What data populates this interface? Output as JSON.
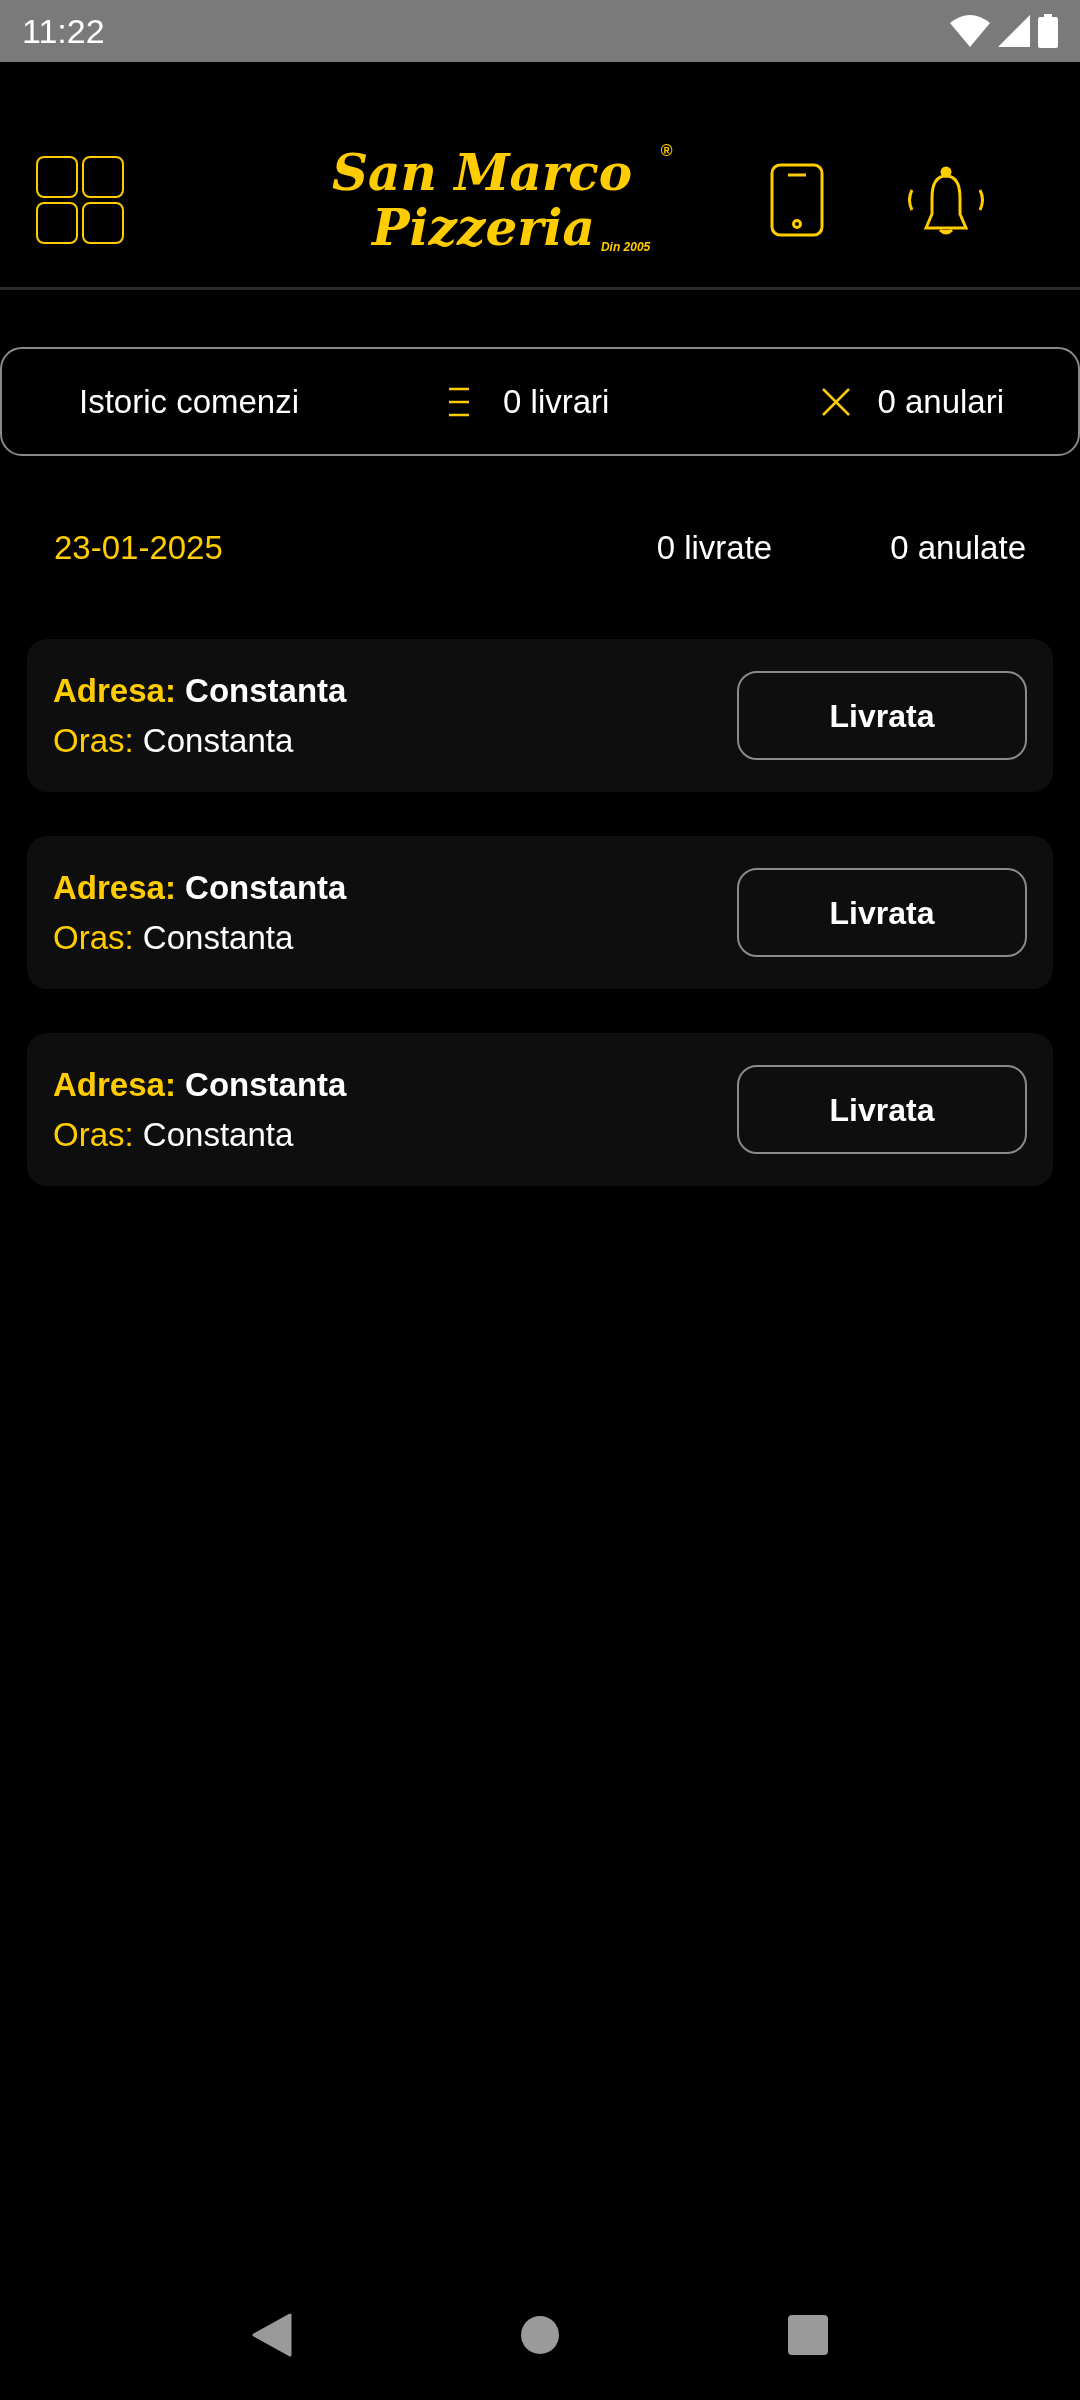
{
  "status_bar": {
    "time": "11:22"
  },
  "header": {
    "logo": {
      "line1": "San Marco",
      "line2": "Pizzeria",
      "tagline": "Din 2005",
      "mark": "®"
    }
  },
  "summary_bar": {
    "title": "Istoric comenzi",
    "delivered": "0 livrari",
    "cancelled": "0 anulari"
  },
  "day": {
    "date": "23-01-2025",
    "delivered": "0 livrate",
    "cancelled": "0 anulate"
  },
  "orders": [
    {
      "address_label": "Adresa:",
      "address": "Constanta",
      "city_label": "Oras:",
      "city": "Constanta",
      "button": "Livrata"
    },
    {
      "address_label": "Adresa:",
      "address": "Constanta",
      "city_label": "Oras:",
      "city": "Constanta",
      "button": "Livrata"
    },
    {
      "address_label": "Adresa:",
      "address": "Constanta",
      "city_label": "Oras:",
      "city": "Constanta",
      "button": "Livrata"
    }
  ]
}
